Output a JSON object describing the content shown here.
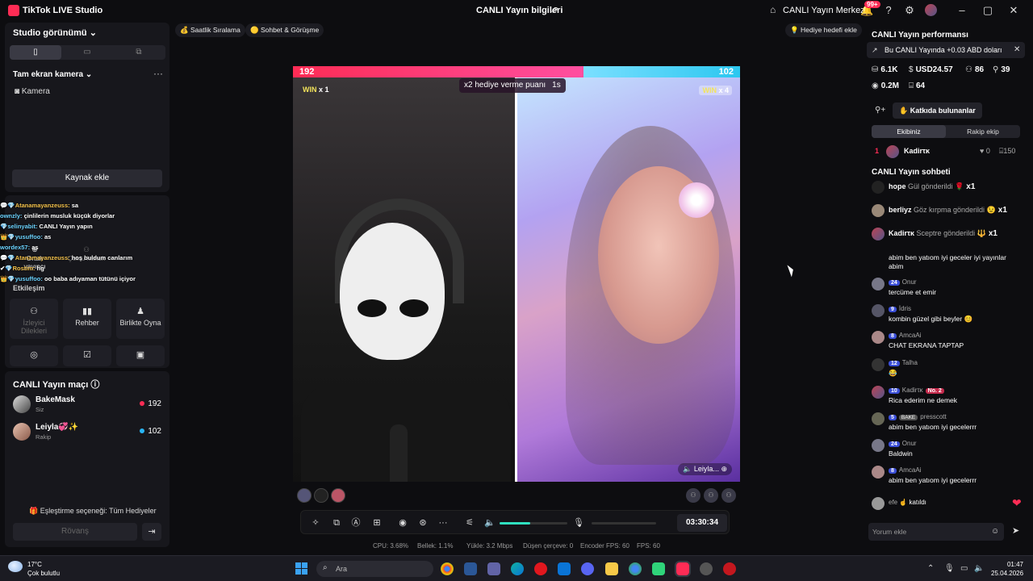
{
  "app": {
    "title": "TikTok LIVE Studio",
    "center_title": "CANLI Yayın bilgileri",
    "live_center": "CANLI Yayın Merkezi",
    "notification_count": "99+"
  },
  "left": {
    "studio_view": "Studio görünümü ⌄",
    "fullscreen_camera": "Tam ekran kamera ⌄",
    "more": "···",
    "camera": "Kamera",
    "add_source": "Kaynak ekle",
    "chat_overlay": [
      {
        "name": "Atanamayanzeuss:",
        "text": " sa"
      },
      {
        "name": "ownzly:",
        "text": " çinlilerin musluk küçük diyorlar"
      },
      {
        "name": "selinyabit:",
        "text": " CANLI Yayın yapın"
      },
      {
        "name": "yusuffoo:",
        "text": " as"
      },
      {
        "name": "wordex57:",
        "text": " as"
      },
      {
        "name": "Atanamayanzeuss:",
        "text": " hoş buldum canlarım"
      },
      {
        "name": "Rostim:",
        "text": " hg"
      },
      {
        "name": "yusuffoo:",
        "text": " oo baba adıyaman tütünü içiyor"
      }
    ],
    "co_host": "Ortak yayıncı",
    "multi_guest": "Çoklu konuk",
    "interaction": "Etkileşim",
    "grid": [
      {
        "label": "İzleyici Dilekleri",
        "icon": "users-icon",
        "glyph": "⚇",
        "dim": true
      },
      {
        "label": "Rehber",
        "icon": "book-icon",
        "glyph": "▮▮",
        "dim": false
      },
      {
        "label": "Birlikte Oyna",
        "icon": "gamepad-icon",
        "glyph": "♟",
        "dim": false
      }
    ],
    "grid2": [
      {
        "icon": "target-icon",
        "glyph": "◎"
      },
      {
        "icon": "checklist-icon",
        "glyph": "☑"
      },
      {
        "icon": "box-icon",
        "glyph": "▣"
      }
    ],
    "match_title": "CANLI Yayın maçı",
    "match": [
      {
        "name": "BakeMask",
        "role": "Siz",
        "score": "192",
        "side": "pink"
      },
      {
        "name": "Leiyla💞✨ ",
        "role": "Rakip",
        "score": "102",
        "side": "blue"
      }
    ],
    "pairing": "Eşleştirme seçeneği: Tüm Hediyeler",
    "rematch": "Rövanş"
  },
  "pills": {
    "hourly": "Saatlik Sıralama",
    "chat_meet": "Sohbet & Görüşme",
    "gift_goal": "Hediye hedefi ekle"
  },
  "battle": {
    "score_left": "192",
    "score_right": "102",
    "score_left_share": 0.65,
    "win_left_label": "WIN",
    "win_left_count": " x 1",
    "win_right_label": "WIN",
    "win_right_count": " x 4",
    "multiplier_text": "x2 hediye verme puanı",
    "multiplier_time": "1s",
    "guest_name": "Leiyla...",
    "timer": "03:30:34",
    "volume_level": 0.45
  },
  "stats": {
    "cpu": "CPU:  3.68%",
    "memory": "Bellek:  1.1%",
    "upload": "Yükle:  3.2 Mbps",
    "dropped": "Düşen çerçeve:  0",
    "encoder_fps": "Encoder FPS:  60",
    "fps": "FPS:  60"
  },
  "right": {
    "performance_title": "CANLI Yayın performansı",
    "notice": "Bu CANLI Yayında +0.03 ABD doları",
    "stats": [
      {
        "icon": "coin-icon",
        "glyph": "⛁",
        "value": "6.1K"
      },
      {
        "icon": "dollar-icon",
        "glyph": "$",
        "value": "USD24.57"
      },
      {
        "icon": "users-icon",
        "glyph": "⚇",
        "value": "86"
      },
      {
        "icon": "person-icon",
        "glyph": "⚲",
        "value": "39"
      },
      {
        "icon": "eye-icon",
        "glyph": "◉",
        "value": "0.2M"
      },
      {
        "icon": "gift-icon",
        "glyph": "⌸",
        "value": "64"
      }
    ],
    "contributors": "Katkıda bulunanlar",
    "team_ours": "Ekibiniz",
    "team_rival": "Rakip ekip",
    "rank": {
      "no": "1",
      "name": "Kadirτκ",
      "likes": "0",
      "gifts": "150"
    },
    "chat_title": "CANLI Yayın sohbeti",
    "gifts": [
      {
        "name": "hope",
        "text": " Gül gönderildi ",
        "emoji": "🌹",
        "count": "x1"
      },
      {
        "name": "berliyz",
        "text": " Göz kırpma gönderildi ",
        "emoji": "😉",
        "count": "x1"
      },
      {
        "name": "Kadirτκ",
        "text": " Sceptre gönderildi ",
        "emoji": "🔱",
        "count": "x1"
      }
    ],
    "partial": "abim ben yatıom iyi geceler iyi yayınlar abim",
    "messages": [
      {
        "lvl": "24",
        "user": "Onur",
        "text": "tercüme et emir"
      },
      {
        "lvl": "9",
        "user": "İdris",
        "text": "kombin güzel gibi beyler 😊"
      },
      {
        "lvl": "8",
        "user": "AmcaAi",
        "text": "CHAT EKRANA TAPTAP"
      },
      {
        "lvl": "12",
        "user": "Talha",
        "text": "😂"
      },
      {
        "lvl": "10",
        "user": "Kadirτκ",
        "badge": "No. 2",
        "text": "Rica ederim ne demek"
      },
      {
        "lvl": "5",
        "user": "presscott",
        "bake": "BAKE",
        "text": "abim ben yatıom iyi gecelerrr"
      },
      {
        "lvl": "24",
        "user": "Onur",
        "text": "Baldwin"
      },
      {
        "lvl": "8",
        "user": "AmcaAi",
        "text": "abim ben yatıom iyi gecelerrr"
      }
    ],
    "joined": {
      "user": "efe",
      "text": " katıldı"
    },
    "comment_placeholder": "Yorum ekle"
  },
  "taskbar": {
    "temp": "17°C",
    "weather": "Çok bulutlu",
    "search": "Ara",
    "time": "01:47",
    "date": "25.04.2026"
  },
  "colors": {
    "accent_pink": "#fe2c55",
    "accent_blue": "#29b6f6",
    "panel": "#17171c"
  }
}
